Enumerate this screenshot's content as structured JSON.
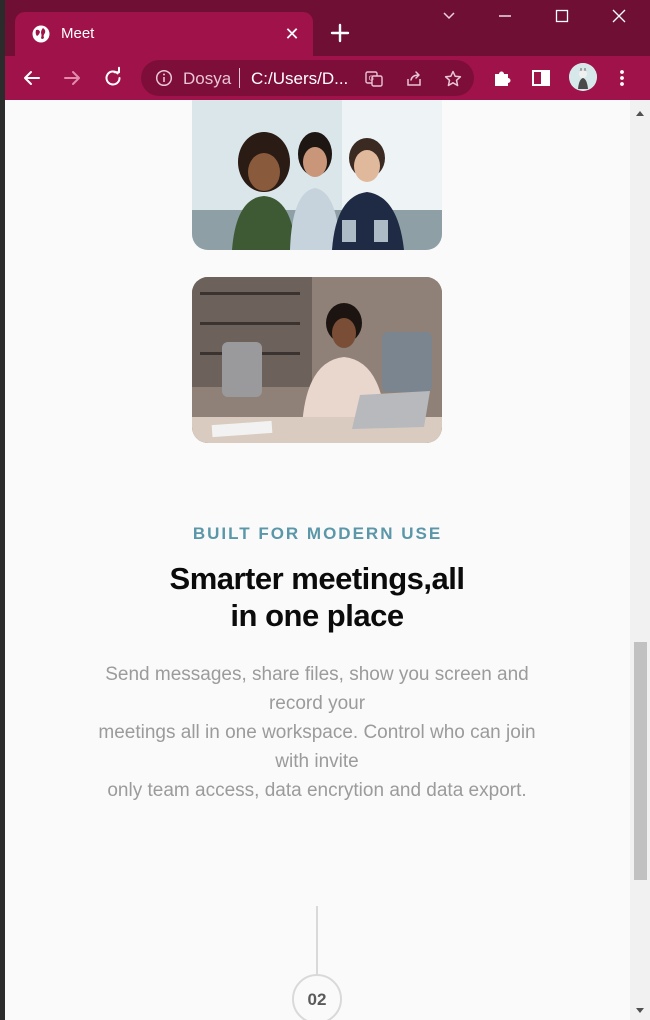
{
  "browser": {
    "tab": {
      "title": "Meet",
      "close_glyph": "✕"
    },
    "omnibox": {
      "site_label": "Dosya",
      "url": "C:/Users/D..."
    },
    "icons": {
      "favicon": "globe-icon",
      "new_tab": "plus-icon",
      "back": "arrow-left-icon",
      "forward": "arrow-right-icon",
      "reload": "reload-icon",
      "info": "info-icon",
      "translate": "translate-icon",
      "share": "share-icon",
      "bookmark": "star-icon",
      "extensions": "puzzle-icon",
      "side_panel": "side-panel-icon",
      "menu": "kebab-menu-icon"
    },
    "colors": {
      "frame": "#6e0f33",
      "toolbar": "#a0134a"
    }
  },
  "page": {
    "eyebrow": "BUILT FOR MODERN USE",
    "headline_line1": "Smarter meetings,all",
    "headline_line2": "in one place",
    "body_lines": [
      "Send messages, share files, show you screen and",
      "record your",
      "meetings all in one workspace. Control who can join",
      "with invite",
      "only team access, data encrytion and data export."
    ],
    "step_number": "02",
    "colors": {
      "eyebrow": "#5a97a8",
      "headline": "#0b0b0b",
      "body": "#9b9b9b"
    }
  }
}
